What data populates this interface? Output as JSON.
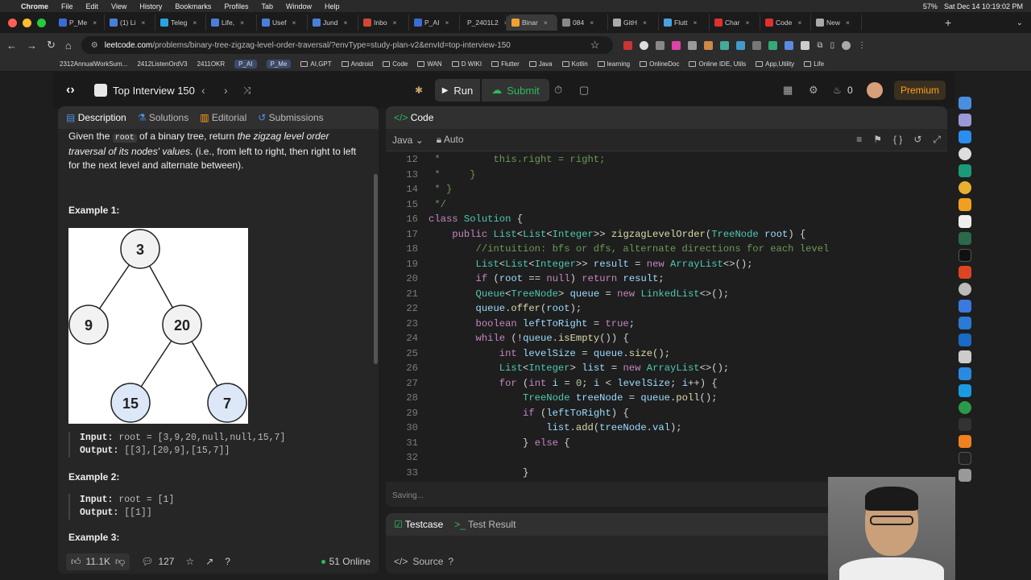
{
  "menubar": {
    "app": "Chrome",
    "items": [
      "File",
      "Edit",
      "View",
      "History",
      "Bookmarks",
      "Profiles",
      "Tab",
      "Window",
      "Help"
    ],
    "battery": "57%",
    "datetime": "Sat Dec 14  10:19:02 PM"
  },
  "tabs": [
    {
      "label": "P_Me",
      "color": "#3b6bd6"
    },
    {
      "label": "(1) Li",
      "color": "#4a7fd9"
    },
    {
      "label": "Teleg",
      "color": "#2aa3e0"
    },
    {
      "label": "Life,",
      "color": "#4a7fd9"
    },
    {
      "label": "Usef",
      "color": "#4a7fd9"
    },
    {
      "label": "Jund",
      "color": "#4a7fd9"
    },
    {
      "label": "Inbo",
      "color": "#d44638"
    },
    {
      "label": "P_AI",
      "color": "#3b6bd6"
    },
    {
      "label": "P_2401L2",
      "color": "#d44a4a"
    },
    {
      "label": "Binar",
      "color": "#f0a030"
    },
    {
      "label": "084",
      "color": "#888"
    },
    {
      "label": "GitH",
      "color": "#aaa"
    },
    {
      "label": "Flutt",
      "color": "#4aa3e0"
    },
    {
      "label": "Char",
      "color": "#e03030"
    },
    {
      "label": "Code",
      "color": "#e03030"
    },
    {
      "label": "New",
      "color": "#aaa"
    }
  ],
  "address": {
    "domain": "leetcode.com",
    "path": "/problems/binary-tree-zigzag-level-order-traversal/?envType=study-plan-v2&envId=top-interview-150"
  },
  "bookmarks": [
    "2312AnnualWorkSum...",
    "2412ListenOrdV3",
    "2411OKR",
    "P_AI",
    "P_Me",
    "AI,GPT",
    "Android",
    "Code",
    "WAN",
    "D WIKI",
    "Flutter",
    "Java",
    "Kotlin",
    "learning",
    "OnlineDoc",
    "Online IDE, Utils",
    "App,Utility",
    "Life"
  ],
  "header": {
    "study_plan": "Top Interview 150",
    "run": "Run",
    "submit": "Submit",
    "streak": "0",
    "premium": "Premium"
  },
  "left_tabs": {
    "description": "Description",
    "solutions": "Solutions",
    "editorial": "Editorial",
    "submissions": "Submissions"
  },
  "description": {
    "p1_a": "Given the ",
    "p1_code": "root",
    "p1_b": " of a binary tree, return ",
    "p1_em": "the zigzag level order traversal of its nodes' values",
    "p1_c": ". (i.e., from left to right, then right to left for the next level and alternate between)."
  },
  "examples": [
    {
      "title": "Example 1:",
      "input_label": "Input:",
      "input": "root = [3,9,20,null,null,15,7]",
      "output_label": "Output:",
      "output": "[[3],[20,9],[15,7]]"
    },
    {
      "title": "Example 2:",
      "input_label": "Input:",
      "input": "root = [1]",
      "output_label": "Output:",
      "output": "[[1]]"
    },
    {
      "title": "Example 3:"
    }
  ],
  "tree_nodes": [
    "3",
    "9",
    "20",
    "15",
    "7"
  ],
  "footer": {
    "likes": "11.1K",
    "comments": "127",
    "online": "51 Online"
  },
  "code_panel": {
    "title": "Code",
    "language": "Java",
    "mode": "Auto",
    "status": "Saving..."
  },
  "code_lines": [
    {
      "n": "12",
      "t": " *         this.right = right;"
    },
    {
      "n": "13",
      "t": " *     }"
    },
    {
      "n": "14",
      "t": " * }"
    },
    {
      "n": "15",
      "t": " */"
    },
    {
      "n": "16",
      "t": "class Solution {"
    },
    {
      "n": "17",
      "t": "    public List<List<Integer>> zigzagLevelOrder(TreeNode root) {"
    },
    {
      "n": "18",
      "t": "        //intuition: bfs or dfs, alternate directions for each level"
    },
    {
      "n": "19",
      "t": "        List<List<Integer>> result = new ArrayList<>();"
    },
    {
      "n": "20",
      "t": "        if (root == null) return result;"
    },
    {
      "n": "21",
      "t": "        Queue<TreeNode> queue = new LinkedList<>();"
    },
    {
      "n": "22",
      "t": "        queue.offer(root);"
    },
    {
      "n": "23",
      "t": "        boolean leftToRight = true;"
    },
    {
      "n": "24",
      "t": "        while (!queue.isEmpty()) {"
    },
    {
      "n": "25",
      "t": "            int levelSize = queue.size();"
    },
    {
      "n": "26",
      "t": "            List<Integer> list = new ArrayList<>();"
    },
    {
      "n": "27",
      "t": "            for (int i = 0; i < levelSize; i++) {"
    },
    {
      "n": "28",
      "t": "                TreeNode treeNode = queue.poll();"
    },
    {
      "n": "29",
      "t": "                if (leftToRight) {"
    },
    {
      "n": "30",
      "t": "                    list.add(treeNode.val);"
    },
    {
      "n": "31",
      "t": "                } else {"
    },
    {
      "n": "32",
      "t": ""
    },
    {
      "n": "33",
      "t": "                }"
    }
  ],
  "testcase_panel": {
    "testcase": "Testcase",
    "test_result": "Test Result",
    "source": "Source"
  }
}
